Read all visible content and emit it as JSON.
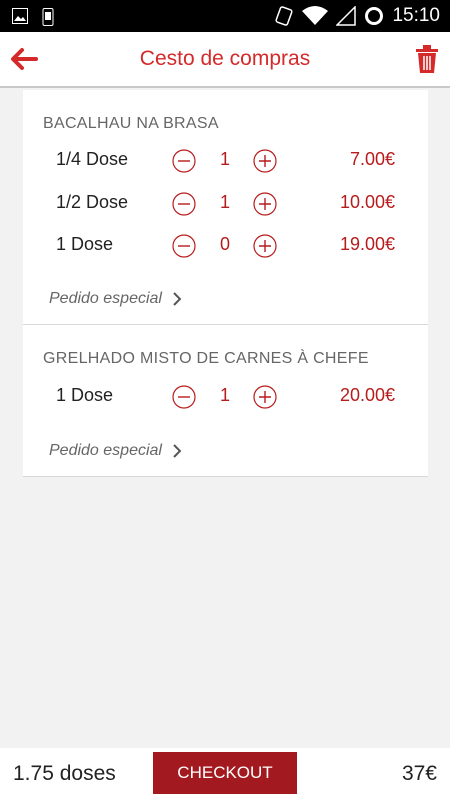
{
  "status_bar": {
    "time": "15:10",
    "icons": [
      "image-icon",
      "phone-icon",
      "vibrate-icon",
      "wifi-icon",
      "signal-icon",
      "sync-icon"
    ]
  },
  "app_bar": {
    "title": "Cesto de compras",
    "accent_color": "#d42a2a"
  },
  "cart": [
    {
      "name": "BACALHAU NA BRASA",
      "options": [
        {
          "label": "1/4 Dose",
          "qty": "1",
          "price": "7.00€"
        },
        {
          "label": "1/2 Dose",
          "qty": "1",
          "price": "10.00€"
        },
        {
          "label": "1 Dose",
          "qty": "0",
          "price": "19.00€"
        }
      ],
      "special_request": "Pedido especial"
    },
    {
      "name": "GRELHADO MISTO DE CARNES À CHEFE",
      "options": [
        {
          "label": "1 Dose",
          "qty": "1",
          "price": "20.00€"
        }
      ],
      "special_request": "Pedido especial"
    }
  ],
  "footer": {
    "doses": "1.75 doses",
    "checkout_label": "CHECKOUT",
    "total": "37€",
    "button_color": "#a21a1f"
  }
}
